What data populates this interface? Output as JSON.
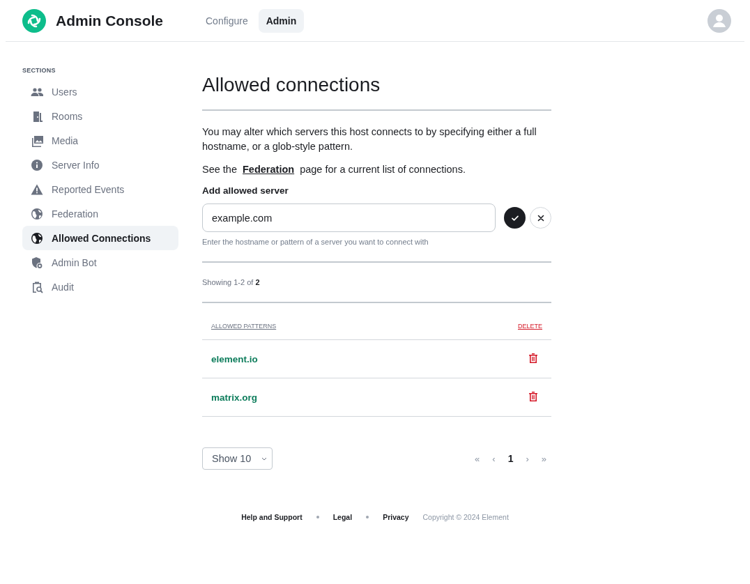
{
  "header": {
    "title": "Admin Console",
    "tabs": [
      {
        "label": "Configure",
        "selected": false
      },
      {
        "label": "Admin",
        "selected": true
      }
    ]
  },
  "sidebar": {
    "heading": "SECTIONS",
    "items": [
      {
        "label": "Users",
        "selected": false
      },
      {
        "label": "Rooms",
        "selected": false
      },
      {
        "label": "Media",
        "selected": false
      },
      {
        "label": "Server Info",
        "selected": false
      },
      {
        "label": "Reported Events",
        "selected": false
      },
      {
        "label": "Federation",
        "selected": false
      },
      {
        "label": "Allowed Connections",
        "selected": true
      },
      {
        "label": "Admin Bot",
        "selected": false
      },
      {
        "label": "Audit",
        "selected": false
      }
    ]
  },
  "page": {
    "title": "Allowed connections",
    "intro": "You may alter which servers this host connects to by specifying either a full hostname, or a glob-style pattern.",
    "federation_note": {
      "before": "See the",
      "link": "Federation",
      "after": "page for a current list of connections."
    },
    "form": {
      "label": "Add allowed server",
      "value": "example.com",
      "hint": "Enter the hostname or pattern of a server you want to connect with"
    },
    "summary": "Showing 1-2 of **2**",
    "table": {
      "columns": [
        "ALLOWED PATTERNS",
        "DELETE"
      ],
      "rows": [
        {
          "pattern": "element.io"
        },
        {
          "pattern": "matrix.org"
        }
      ]
    },
    "page_size": "Show 10",
    "pagination": {
      "first": "«",
      "prev": "‹",
      "current": "1",
      "next": "›",
      "last": "»"
    }
  },
  "footer": {
    "links": [
      "Help and Support",
      "Legal",
      "Privacy"
    ],
    "copyright": "Copyright © 2024 Element"
  }
}
